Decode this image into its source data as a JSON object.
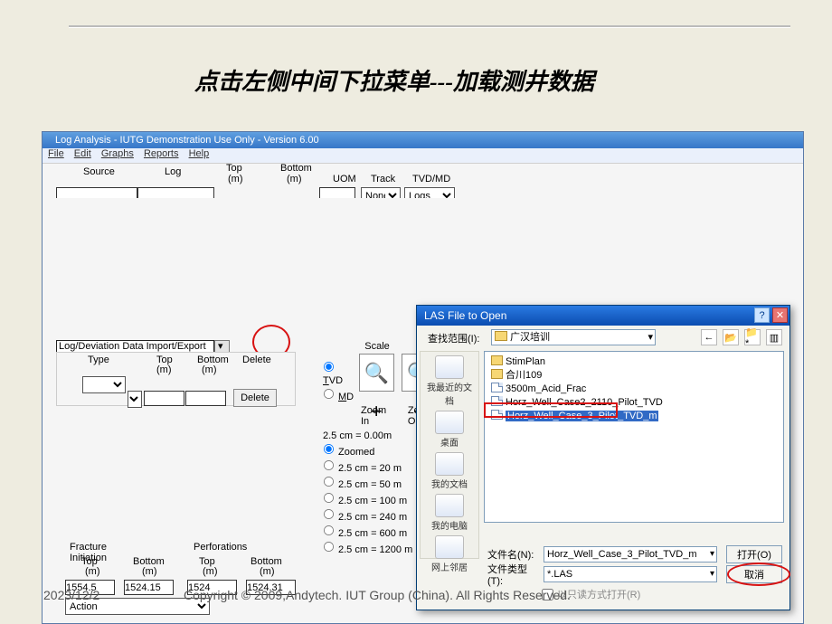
{
  "slide": {
    "instruction": "点击左侧中间下拉菜单---加载测井数据",
    "timestamp": "2023/12/2",
    "copyright": "Copyright © 2009,Andytech. IUT Group (China). All Rights Reserved."
  },
  "app": {
    "title": "Log Analysis - IUTG Demonstration Use Only - Version 6.00",
    "menu": {
      "file": "File",
      "edit": "Edit",
      "graphs": "Graphs",
      "reports": "Reports",
      "help": "Help"
    }
  },
  "cols": {
    "source": "Source",
    "log": "Log",
    "top": "Top",
    "topm": "(m)",
    "bottom": "Bottom",
    "bottomm": "(m)",
    "uom": "UOM",
    "track": "Track",
    "track_val": "None",
    "tvdmd": "TVD/MD",
    "tvdmd_val": "Logs"
  },
  "import_row": {
    "label": "Log/Deviation Data Import/Export"
  },
  "lower_cols": {
    "type": "Type",
    "top": "Top",
    "topm": "(m)",
    "bottom": "Bottom",
    "bottomm": "(m)",
    "delete": "Delete",
    "delete_btn": "Delete"
  },
  "scale": {
    "title": "Scale",
    "tvd": "TVD",
    "md": "MD",
    "zoom_in": "Zoom In",
    "zoom_out": "Zoom Out",
    "base": "2.5 cm = 0.00m",
    "zoomed": "Zoomed",
    "r1": "2.5 cm = 20 m",
    "r2": "2.5 cm = 50 m",
    "r3": "2.5 cm = 100 m",
    "r4": "2.5 cm = 240 m",
    "r5": "2.5 cm = 600 m",
    "r6": "2.5 cm = 1200 m"
  },
  "frac": {
    "init": "Fracture Initiation",
    "perf": "Perforations",
    "top": "Top",
    "bottom": "Bottom",
    "m": "(m)",
    "v1": "1554.5",
    "v2": "1524.15",
    "v3": "1524",
    "v4": "1524.31",
    "action": "Action"
  },
  "dialog": {
    "title": "LAS File to Open",
    "look_in_label": "查找范围(I):",
    "look_in_value": "广汉培训",
    "nav": {
      "back": "←",
      "up": "📂",
      "new": "📁*",
      "view": "▥"
    },
    "places": {
      "recent": "我最近的文档",
      "desktop": "桌面",
      "mydocs": "我的文档",
      "mycomp": "我的电脑",
      "network": "网上邻居"
    },
    "files": {
      "f0": "StimPlan",
      "f1": "合川109",
      "f2": "3500m_Acid_Frac",
      "f3": "Horz_Well_Case2_2110_Pilot_TVD",
      "f4": "Horz_Well_Case_3_Pilot_TVD_m"
    },
    "filename_label": "文件名(N):",
    "filename_value": "Horz_Well_Case_3_Pilot_TVD_m",
    "filetype_label": "文件类型(T):",
    "filetype_value": "*.LAS",
    "readonly": "以只读方式打开(R)",
    "open": "打开(O)",
    "cancel": "取消"
  }
}
